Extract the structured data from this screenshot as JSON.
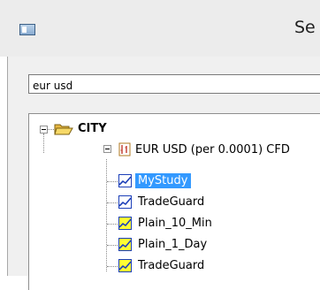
{
  "window": {
    "title": "Se",
    "icon": "app-window-icon"
  },
  "search": {
    "value": "eur usd"
  },
  "tree": {
    "root": {
      "label": "CITY",
      "icon": "folder-open-icon",
      "expanded": true
    },
    "instrument": {
      "label": "EUR USD (per 0.0001) CFD",
      "icon": "instrument-icon",
      "expanded": true
    },
    "items": [
      {
        "label": "MyStudy",
        "icon": "study-icon-white",
        "selected": true
      },
      {
        "label": "TradeGuard",
        "icon": "study-icon-white",
        "selected": false
      },
      {
        "label": "Plain_10_Min",
        "icon": "study-icon-yellow",
        "selected": false
      },
      {
        "label": "Plain_1_Day",
        "icon": "study-icon-yellow",
        "selected": false
      },
      {
        "label": "TradeGuard",
        "icon": "study-icon-yellow",
        "selected": false
      }
    ]
  },
  "colors": {
    "selection": "#3399ff",
    "study_icon_yellow": "#ffff33",
    "study_icon_white": "#ffffff",
    "study_line": "#1c3fb8",
    "folder": "#f5d161",
    "instrument": "#c8902e"
  }
}
